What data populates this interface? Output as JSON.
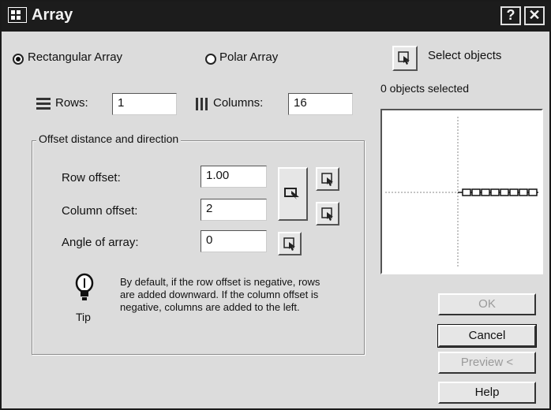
{
  "window": {
    "title": "Array",
    "help_icon": "question-mark-icon",
    "close_icon": "close-icon"
  },
  "array_type": {
    "rectangular_label": "Rectangular Array",
    "polar_label": "Polar Array",
    "selected": "rectangular"
  },
  "select_objects": {
    "button_icon": "select-objects-icon",
    "label": "Select objects",
    "status": "0 objects selected"
  },
  "rows": {
    "label": "Rows:",
    "value": "1"
  },
  "columns": {
    "label": "Columns:",
    "value": "16"
  },
  "offset_group": {
    "legend": "Offset distance and direction",
    "row_offset": {
      "label": "Row offset:",
      "value": "1.00"
    },
    "column_offset": {
      "label": "Column offset:",
      "value": "2"
    },
    "angle": {
      "label": "Angle of array:",
      "value": "0"
    }
  },
  "tip": {
    "icon": "lightbulb-icon",
    "label": "Tip",
    "text": "By default, if the row offset is negative, rows are added downward. If the column offset is negative, columns are added to the left."
  },
  "buttons": {
    "ok": "OK",
    "cancel": "Cancel",
    "preview": "Preview <",
    "help": "Help"
  }
}
